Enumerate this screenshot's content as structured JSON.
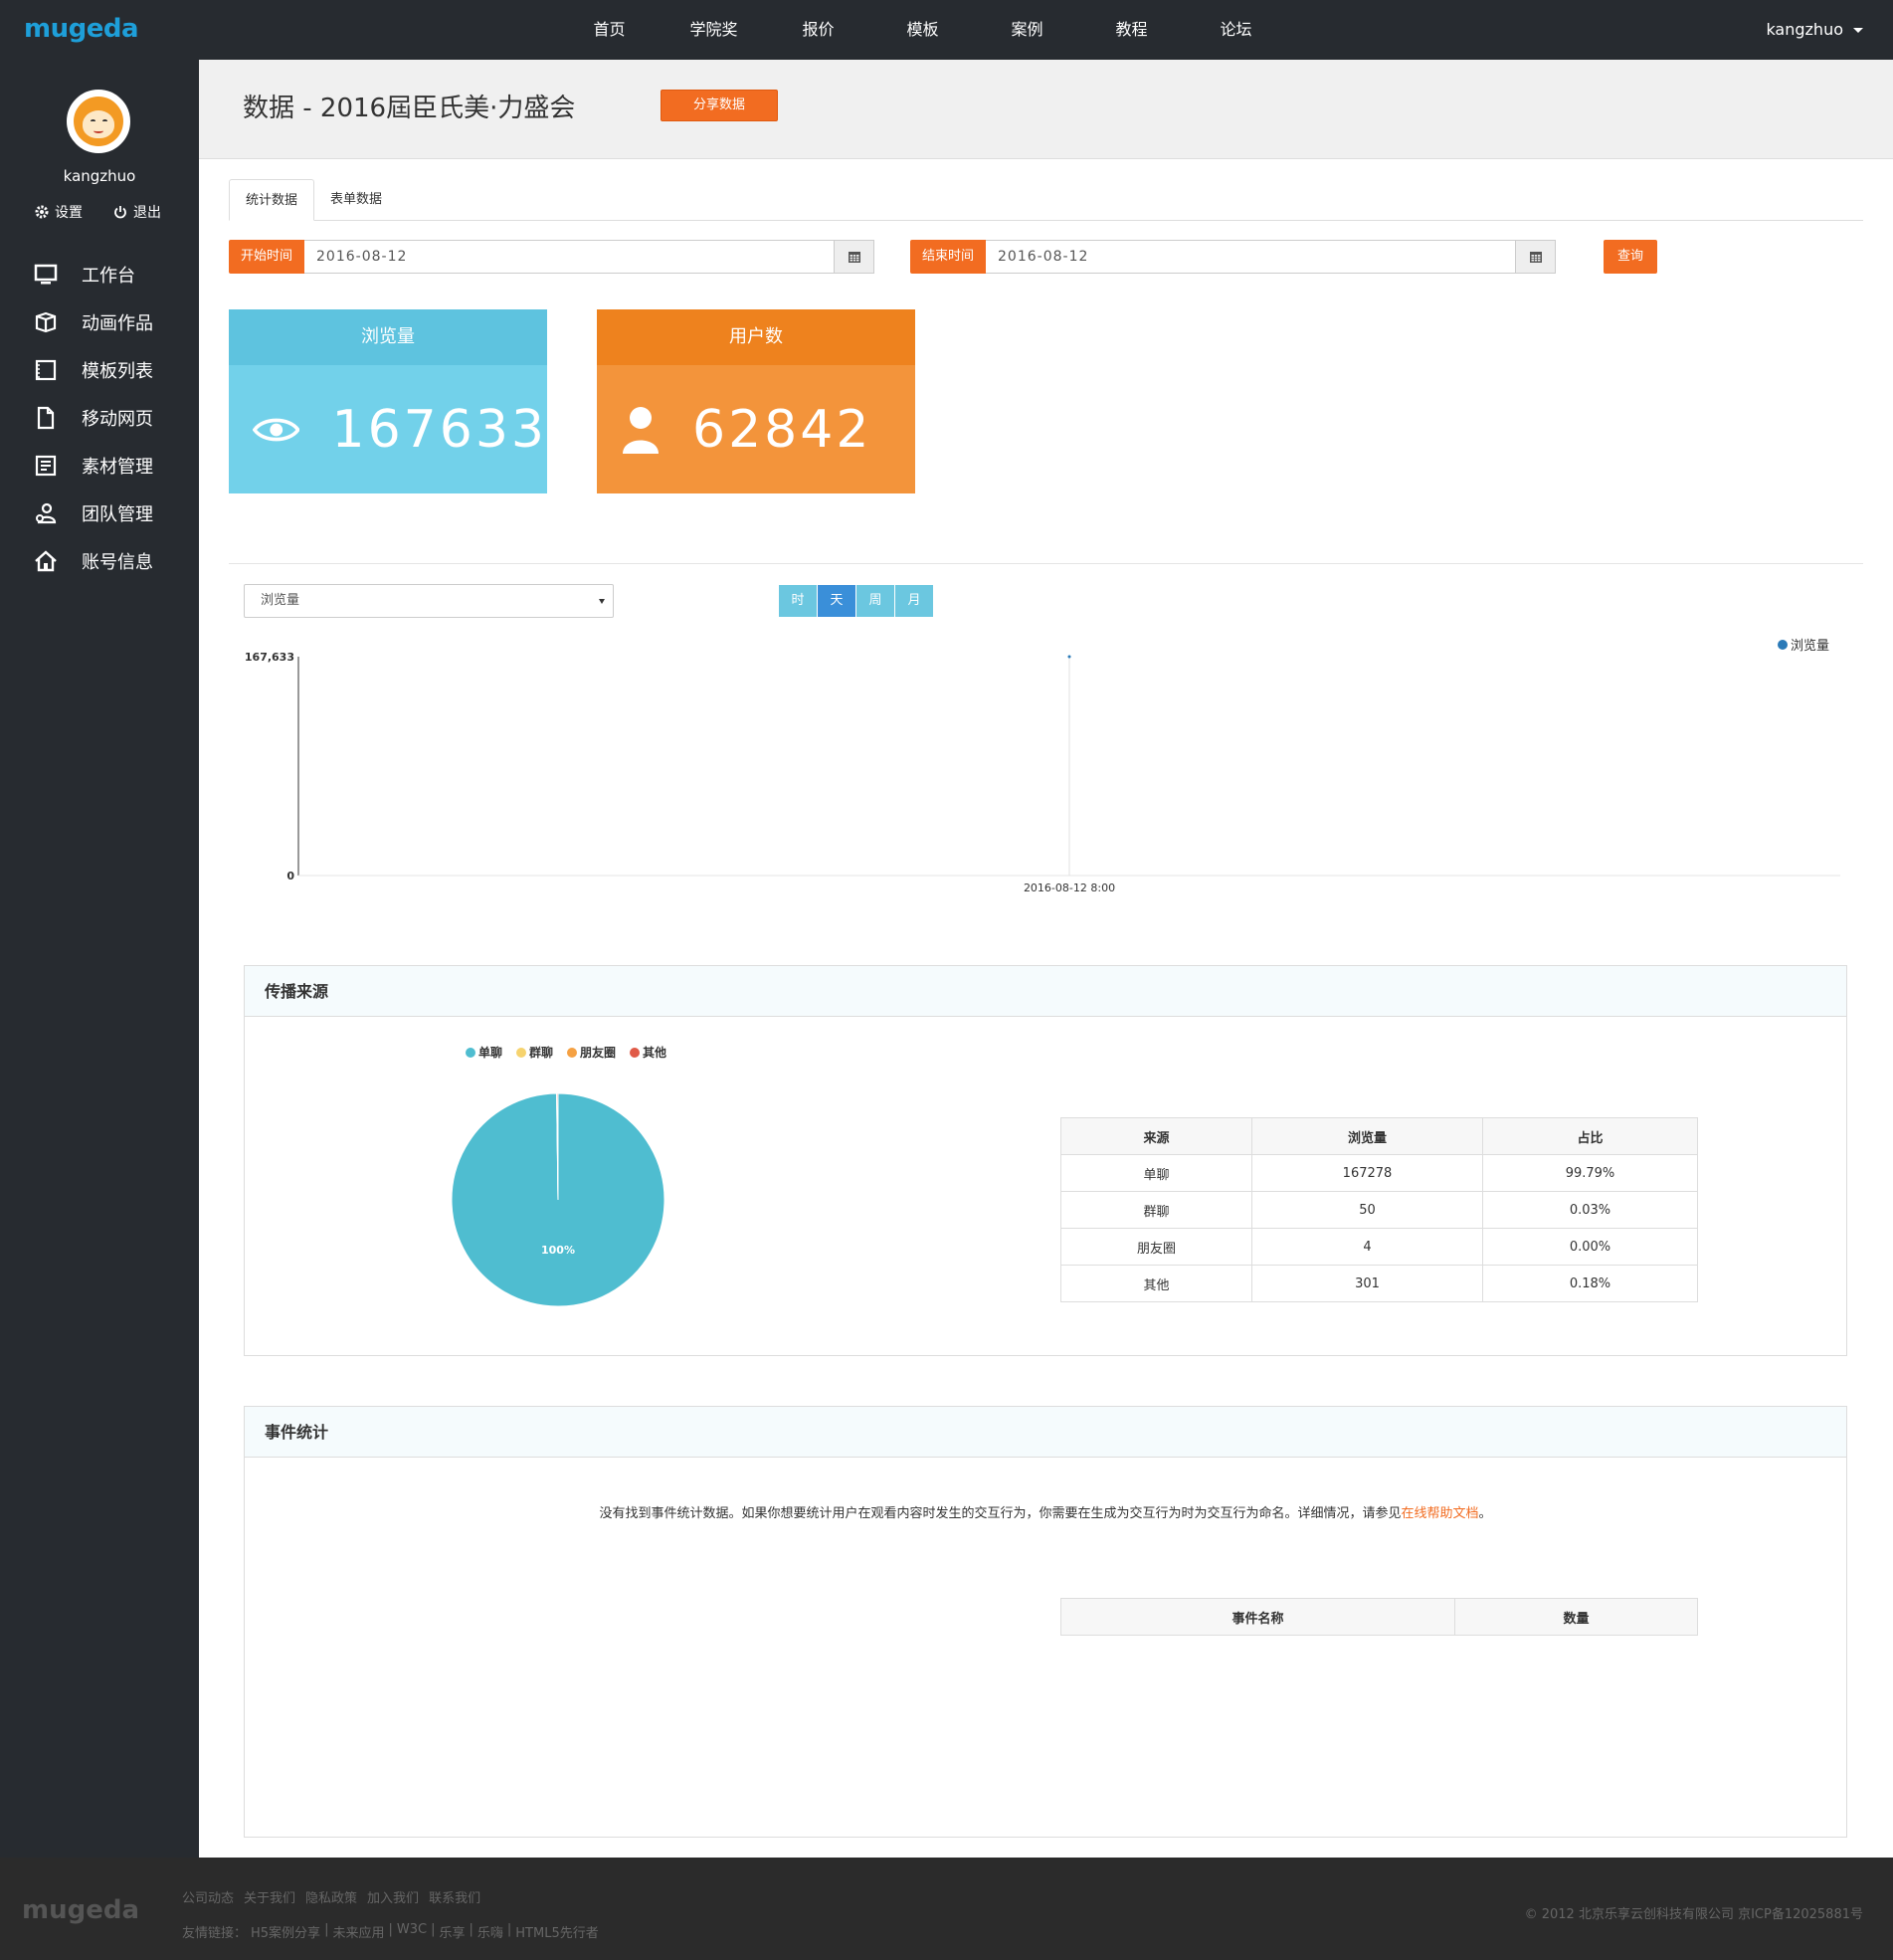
{
  "brand": {
    "logo": "mugeda",
    "accent": "#f26c21",
    "sidebar_bg": "#272b30"
  },
  "nav": {
    "items": [
      "首页",
      "学院奖",
      "报价",
      "模板",
      "案例",
      "教程",
      "论坛"
    ],
    "user": "kangzhuo"
  },
  "sidebar": {
    "username": "kangzhuo",
    "settings": "设置",
    "logout": "退出",
    "items": [
      {
        "label": "工作台",
        "icon": "monitor-icon"
      },
      {
        "label": "动画作品",
        "icon": "box-icon"
      },
      {
        "label": "模板列表",
        "icon": "film-icon"
      },
      {
        "label": "移动网页",
        "icon": "file-icon"
      },
      {
        "label": "素材管理",
        "icon": "list-icon"
      },
      {
        "label": "团队管理",
        "icon": "team-icon"
      },
      {
        "label": "账号信息",
        "icon": "home-icon"
      }
    ]
  },
  "header": {
    "title": "数据 - 2016屆臣氏美·力盛会",
    "share_label": "分享数据"
  },
  "tabs": [
    "统计数据",
    "表单数据"
  ],
  "filters": {
    "start_label": "开始时间",
    "start_value": "2016-08-12",
    "end_label": "结束时间",
    "end_value": "2016-08-12",
    "query_label": "查询"
  },
  "stats": {
    "views_label": "浏览量",
    "views_value": "167633",
    "users_label": "用户数",
    "users_value": "62842"
  },
  "chart_controls": {
    "metric": "浏览量",
    "periods": [
      "时",
      "天",
      "周",
      "月"
    ],
    "active_period": "天"
  },
  "chart_data": [
    {
      "type": "line",
      "series": [
        {
          "name": "浏览量",
          "color": "#2a7ab8",
          "x": [
            "2016-08-12 8:00"
          ],
          "values": [
            167633
          ]
        }
      ],
      "y_tick_labels": [
        "167,633",
        "0"
      ],
      "x_tick_labels": [
        "2016-08-12 8:00"
      ],
      "ylim": [
        0,
        167633
      ],
      "legend": "top-right",
      "grid": false
    },
    {
      "type": "pie",
      "categories": [
        "单聊",
        "群聊",
        "朋友圈",
        "其他"
      ],
      "values": [
        167278,
        50,
        4,
        301
      ],
      "colors": [
        "#4fbdd0",
        "#f6d36e",
        "#f5a143",
        "#e05a47"
      ],
      "slice_label": "100%",
      "legend": "top"
    }
  ],
  "source_panel": {
    "title": "传播来源",
    "headers": [
      "来源",
      "浏览量",
      "占比"
    ],
    "rows": [
      [
        "单聊",
        "167278",
        "99.79%"
      ],
      [
        "群聊",
        "50",
        "0.03%"
      ],
      [
        "朋友圈",
        "4",
        "0.00%"
      ],
      [
        "其他",
        "301",
        "0.18%"
      ]
    ]
  },
  "event_panel": {
    "title": "事件统计",
    "notice": "没有找到事件统计数据。如果你想要统计用户在观看内容时发生的交互行为，你需要在生成为交互行为时为交互行为命名。详细情况，请参见",
    "notice_link": "在线帮助文档",
    "notice_end": "。",
    "headers": [
      "事件名称",
      "数量"
    ]
  },
  "footer": {
    "logo": "mugeda",
    "links": [
      "公司动态",
      "关于我们",
      "隐私政策",
      "加入我们",
      "联系我们"
    ],
    "friend_label": "友情链接：",
    "friend_links": [
      "H5案例分享",
      "未来应用",
      "W3C",
      "乐享",
      "乐嗨",
      "HTML5先行者"
    ],
    "copyright": "© 2012 北京乐享云创科技有限公司 京ICP备12025881号"
  }
}
